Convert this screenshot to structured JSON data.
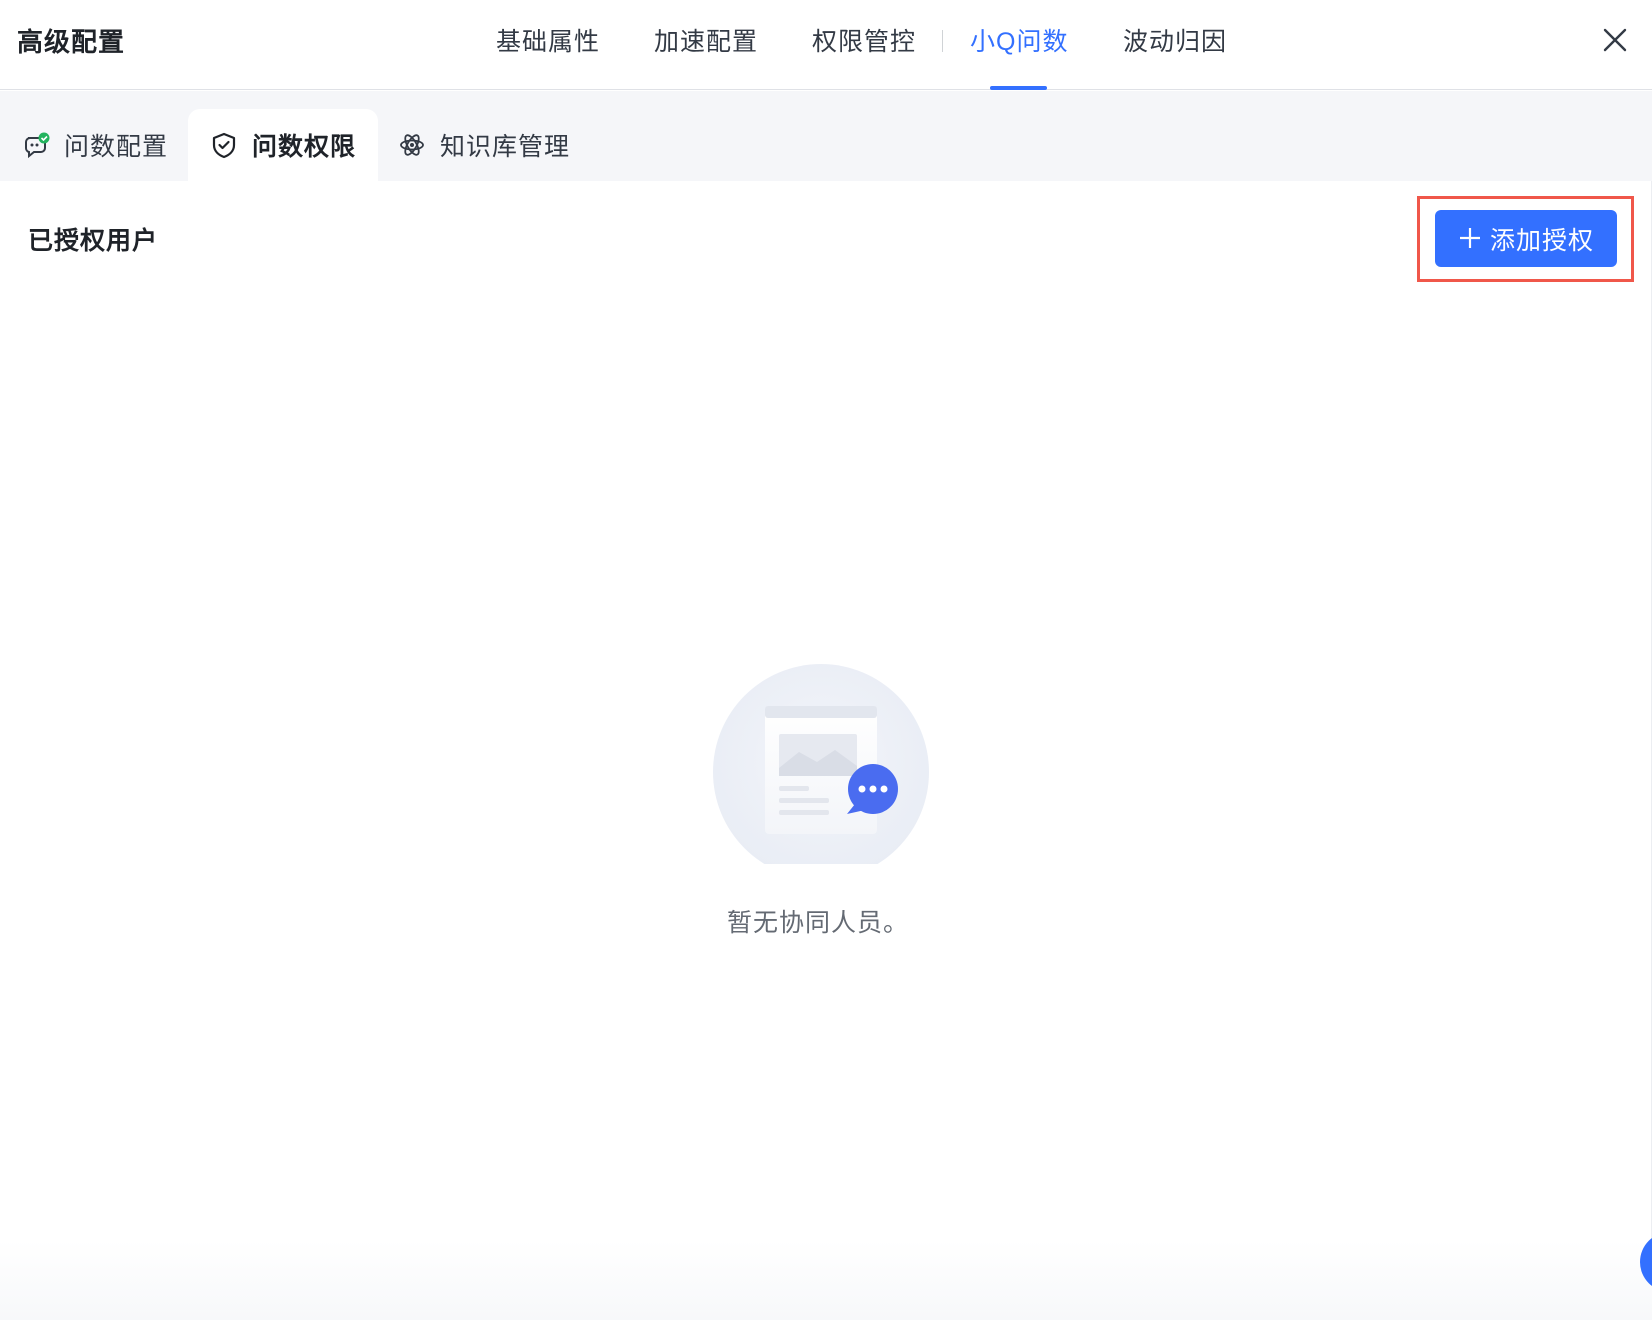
{
  "header": {
    "title": "高级配置",
    "tabs": [
      {
        "label": "基础属性",
        "active": false
      },
      {
        "label": "加速配置",
        "active": false
      },
      {
        "label": "权限管控",
        "active": false
      },
      {
        "label": "小Q问数",
        "active": true
      },
      {
        "label": "波动归因",
        "active": false
      }
    ],
    "close_icon": "close-icon"
  },
  "subnav": {
    "tabs": [
      {
        "label": "问数配置",
        "icon": "chat-check-icon",
        "active": false
      },
      {
        "label": "问数权限",
        "icon": "shield-check-icon",
        "active": true
      },
      {
        "label": "知识库管理",
        "icon": "atom-icon",
        "active": false
      }
    ]
  },
  "main": {
    "section_title": "已授权用户",
    "add_button_label": "添加授权",
    "empty_text": "暂无协同人员。"
  },
  "colors": {
    "accent": "#3370ff",
    "highlight": "#f0574a",
    "status_green": "#22b35e"
  }
}
